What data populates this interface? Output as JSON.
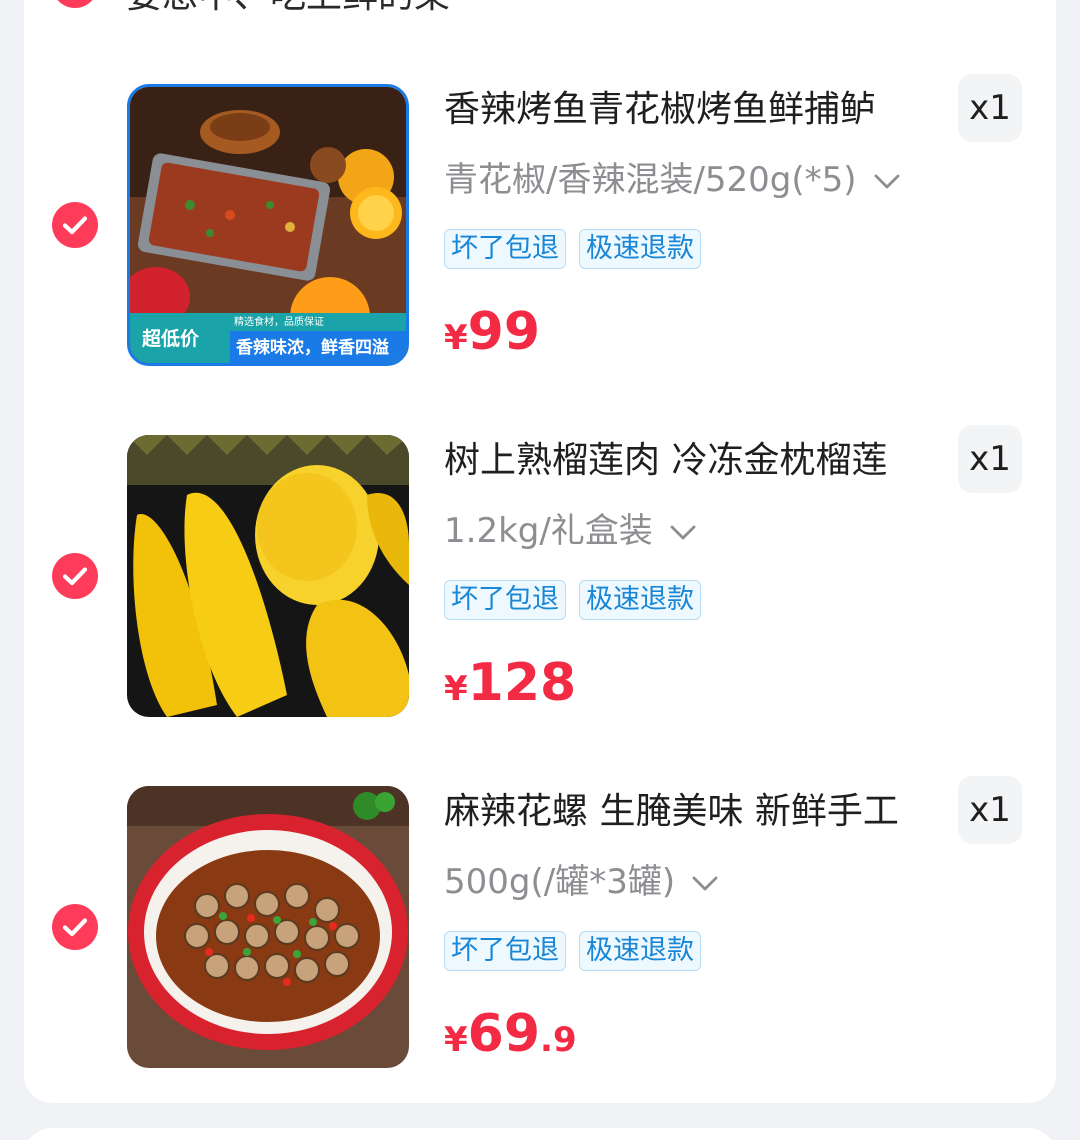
{
  "section": {
    "title": "要想中、吃上鲜的菜"
  },
  "items": [
    {
      "title": "香辣烤鱼青花椒烤鱼鲜捕鲈",
      "spec": "青花椒/香辣混装/520g(*5)",
      "qty": "x1",
      "tags": [
        "坏了包退",
        "极速退款"
      ],
      "price_symbol": "¥",
      "price_int": "99",
      "price_dec": "",
      "image": {
        "badge": "超低价",
        "subtitle_small": "精选食材，品质保证",
        "subtitle": "香辣味浓，鲜香四溢"
      }
    },
    {
      "title": "树上熟榴莲肉 冷冻金枕榴莲",
      "spec": "1.2kg/礼盒装",
      "qty": "x1",
      "tags": [
        "坏了包退",
        "极速退款"
      ],
      "price_symbol": "¥",
      "price_int": "128",
      "price_dec": ""
    },
    {
      "title": "麻辣花螺 生腌美味 新鲜手工",
      "spec": "500g(/罐*3罐)",
      "qty": "x1",
      "tags": [
        "坏了包退",
        "极速退款"
      ],
      "price_symbol": "¥",
      "price_int": "69",
      "price_dec": ".9"
    }
  ],
  "colors": {
    "accent_red": "#f22a44",
    "check_red": "#ff3b5a",
    "tag_blue": "#1a86d6",
    "page_bg": "#f1f2f5"
  },
  "icons": {
    "check": "checkmark-circle-icon",
    "chevron": "chevron-down-icon"
  }
}
